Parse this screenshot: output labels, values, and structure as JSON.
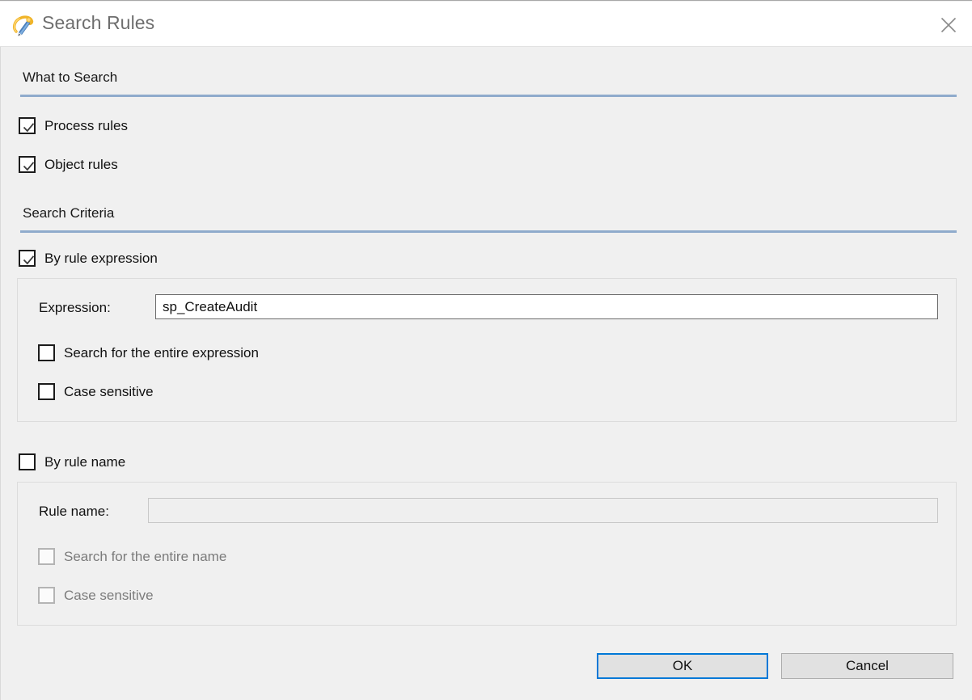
{
  "window": {
    "title": "Search Rules",
    "app_icon": "pencil-rules-icon",
    "close_icon": "close-icon"
  },
  "sections": {
    "what_to_search": {
      "heading": "What to Search",
      "options": [
        {
          "label": "Process rules",
          "checked": true,
          "enabled": true
        },
        {
          "label": "Object rules",
          "checked": true,
          "enabled": true
        }
      ]
    },
    "search_criteria": {
      "heading": "Search Criteria",
      "by_rule_expression": {
        "label": "By rule expression",
        "checked": true,
        "enabled": true,
        "expression_label": "Expression:",
        "expression_value": "sp_CreateAudit",
        "expression_placeholder": "",
        "options": [
          {
            "label": "Search for the entire expression",
            "checked": false,
            "enabled": true
          },
          {
            "label": "Case sensitive",
            "checked": false,
            "enabled": true
          }
        ]
      },
      "by_rule_name": {
        "label": "By rule name",
        "checked": false,
        "enabled": true,
        "name_label": "Rule name:",
        "name_value": "",
        "name_placeholder": "",
        "options": [
          {
            "label": "Search for the entire name",
            "checked": false,
            "enabled": false
          },
          {
            "label": "Case sensitive",
            "checked": false,
            "enabled": false
          }
        ]
      }
    }
  },
  "footer": {
    "ok_label": "OK",
    "cancel_label": "Cancel"
  },
  "colors": {
    "accent_focus": "#0078d7",
    "separator": "#8fabcc",
    "dialog_background": "#f0f0f0",
    "titlebar_background": "#ffffff",
    "title_text": "#6e6e6e"
  }
}
